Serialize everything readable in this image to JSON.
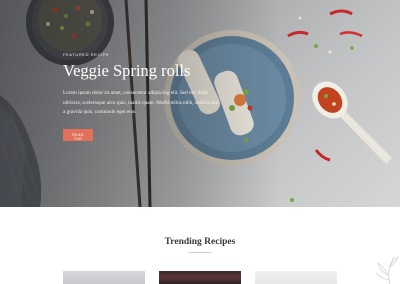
{
  "hero": {
    "eyebrow": "FEATURED RECIPE",
    "title": "Veggie Spring rolls",
    "description": "Lorem ipsum dolor sit amet, consectetur adipiscing elit. Sed nec diam ultricies, scelerisque arcu quis, mattis quam. Morbi tellus nibh, sollicitudin a gravida quis, commodo eget eros.",
    "cta_label": "READ THE"
  },
  "trending": {
    "title": "Trending Recipes",
    "cards": [
      {
        "name": "recipe-card-1"
      },
      {
        "name": "recipe-card-2"
      },
      {
        "name": "recipe-card-3"
      }
    ]
  },
  "colors": {
    "accent": "#e3715a",
    "hero_text": "#ffffff",
    "heading": "#3a3a3a"
  }
}
